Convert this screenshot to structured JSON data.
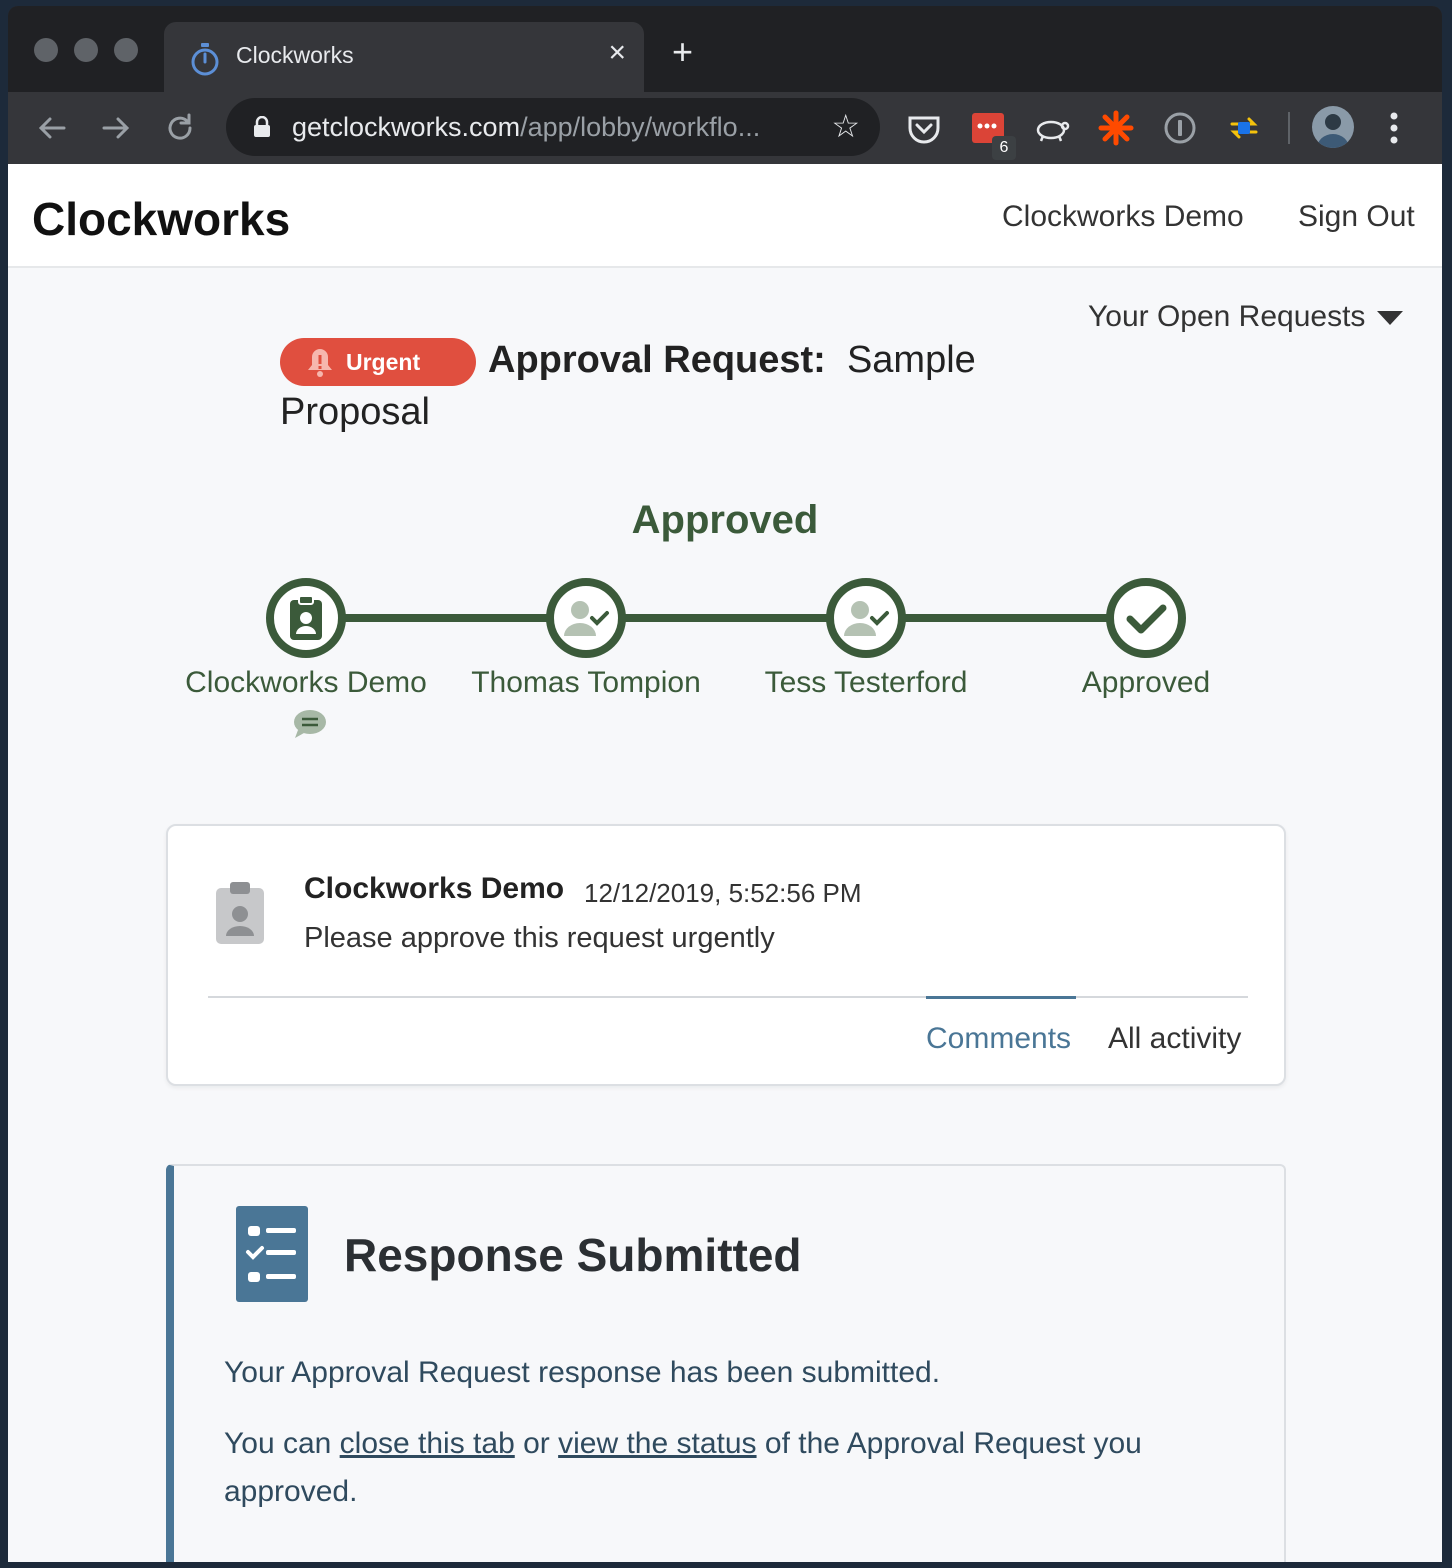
{
  "browser": {
    "tab_title": "Clockworks",
    "url_host": "getclockworks.com",
    "url_path": "/app/lobby/workflo...",
    "extension_badge": "6"
  },
  "header": {
    "brand": "Clockworks",
    "nav_user": "Clockworks Demo",
    "nav_signout": "Sign Out"
  },
  "open_requests_label": "Your Open Requests",
  "request": {
    "urgent_label": "Urgent",
    "title_prefix": "Approval Request:",
    "title_name": "Sample Proposal"
  },
  "status_heading": "Approved",
  "steps": [
    {
      "label": "Clockworks Demo"
    },
    {
      "label": "Thomas Tompion"
    },
    {
      "label": "Tess Testerford"
    },
    {
      "label": "Approved"
    }
  ],
  "comment": {
    "author": "Clockworks Demo",
    "timestamp": "12/12/2019, 5:52:56 PM",
    "text": "Please approve this request urgently",
    "tab_comments": "Comments",
    "tab_all_activity": "All activity"
  },
  "response": {
    "title": "Response Submitted",
    "message": "Your Approval Request response has been submitted.",
    "p2_before": "You can ",
    "link_close": "close this tab",
    "p2_middle": " or ",
    "link_status": "view the status",
    "p2_after": " of the Approval Request you approved."
  },
  "colors": {
    "green": "#3b5a3a",
    "urgent": "#e04f3f",
    "accent_blue": "#4a7696"
  }
}
